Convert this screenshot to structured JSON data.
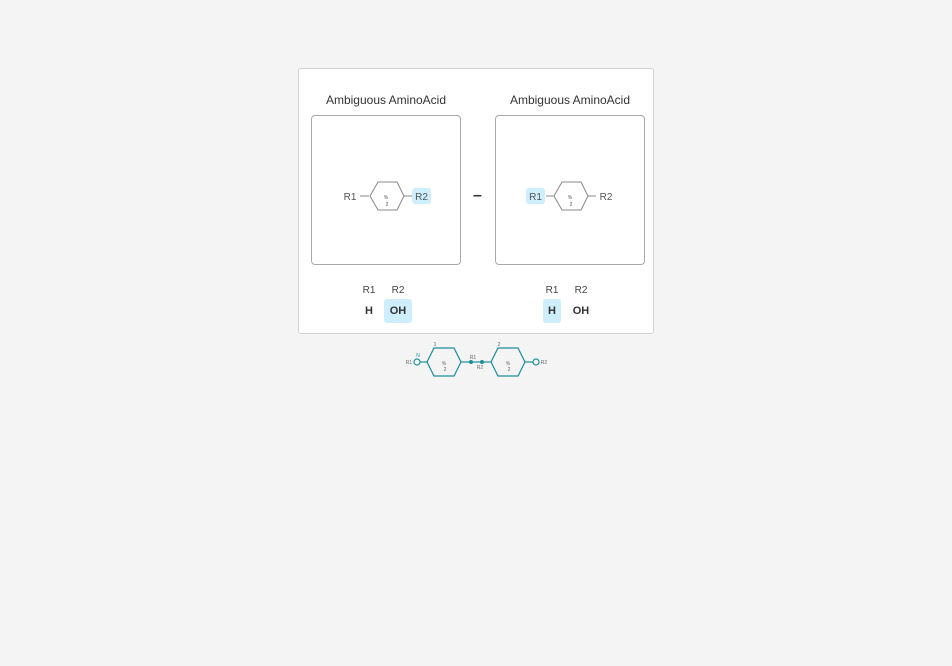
{
  "left": {
    "title": "Ambiguous AminoAcid",
    "r1_label": "R1",
    "r2_label": "R2",
    "ring_text_top": "%",
    "ring_text_bottom": "2",
    "caps": {
      "head_r1": "R1",
      "head_r2": "R2",
      "val_r1": "H",
      "val_r2": "OH"
    }
  },
  "separator": "–",
  "right": {
    "title": "Ambiguous AminoAcid",
    "r1_label": "R1",
    "r2_label": "R2",
    "ring_text_top": "%",
    "ring_text_bottom": "2",
    "caps": {
      "head_r1": "R1",
      "head_r2": "R2",
      "val_r1": "H",
      "val_r2": "OH"
    }
  },
  "chain": {
    "n_term": "N",
    "left_cap": "R1",
    "monomer1_index": "1",
    "monomer2_index": "2",
    "link_r1": "R1",
    "link_r2": "R2",
    "right_cap": "R2",
    "ring_text_top": "%",
    "ring_text_bottom": "2"
  },
  "colors": {
    "selected_bg": "#cdeefa",
    "chain_teal": "#1a8f9a"
  }
}
